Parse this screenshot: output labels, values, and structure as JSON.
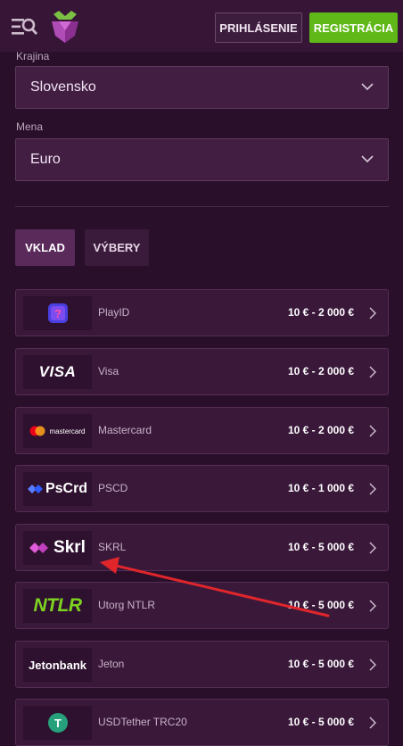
{
  "header": {
    "login_label": "PRIHLÁSENIE",
    "register_label": "REGISTRÁCIA",
    "menu_icon": "menu-search-icon",
    "logo_icon": "raspberry-logo-icon"
  },
  "form": {
    "country_label": "Krajina",
    "country_value": "Slovensko",
    "currency_label": "Mena",
    "currency_value": "Euro"
  },
  "tabs": {
    "deposit": "VKLAD",
    "withdraw": "VÝBERY"
  },
  "methods": [
    {
      "logo_text": "?",
      "name": "PlayID",
      "range": "10 € - 2 000 €"
    },
    {
      "logo_text": "VISA",
      "name": "Visa",
      "range": "10 € - 2 000 €"
    },
    {
      "logo_text": "mastercard",
      "name": "Mastercard",
      "range": "10 € - 2 000 €"
    },
    {
      "logo_text": "PsCrd",
      "name": "PSCD",
      "range": "10 € - 1 000 €"
    },
    {
      "logo_text": "Skrl",
      "name": "SKRL",
      "range": "10 € - 5 000 €"
    },
    {
      "logo_text": "NTLR",
      "name": "Utorg NTLR",
      "range": "10 € - 5 000 €"
    },
    {
      "logo_text": "Jetonbank",
      "name": "Jeton",
      "range": "10 € - 5 000 €"
    },
    {
      "logo_text": "T",
      "name": "USDTether TRC20",
      "range": "10 € - 5 000 €"
    }
  ],
  "colors": {
    "background": "#2a0f2a",
    "accent_green": "#5fb817",
    "annotation_arrow": "#e0262b"
  }
}
